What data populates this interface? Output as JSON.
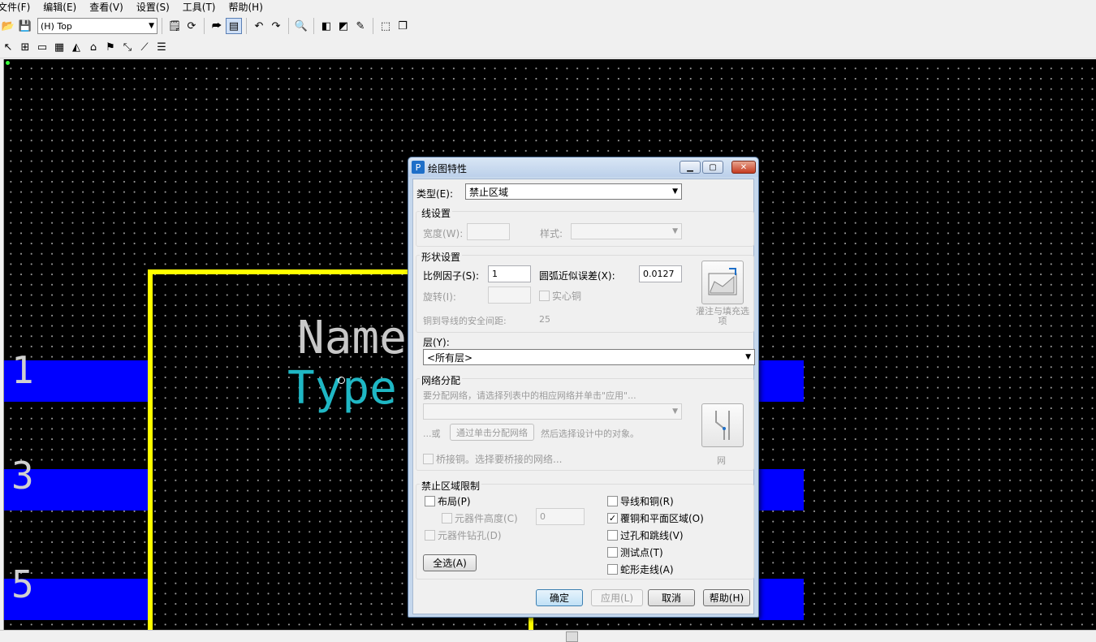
{
  "menu": [
    "文件(F)",
    "编辑(E)",
    "查看(V)",
    "设置(S)",
    "工具(T)",
    "帮助(H)"
  ],
  "toolbar": {
    "layer_selected": "(H) Top"
  },
  "canvas": {
    "pin_numbers": [
      "1",
      "3",
      "5"
    ],
    "name_text": "Name",
    "type_text": "Type",
    "colors": {
      "background": "#000000",
      "pad": "#0000ff",
      "outline": "#ffff00",
      "name_text": "#c8c8c8",
      "type_text": "#1fb7c4"
    }
  },
  "dialog": {
    "title": "绘图特性",
    "type_label": "类型(E):",
    "type_value": "禁止区域",
    "line_settings": {
      "title": "线设置",
      "width_label": "宽度(W):",
      "style_label": "样式:"
    },
    "shape_settings": {
      "title": "形状设置",
      "scale_label": "比例因子(S):",
      "scale_value": "1",
      "arc_label": "圆弧近似误差(X):",
      "arc_value": "0.0127",
      "rotate_label": "旋转(I):",
      "solid_copper_label": "实心铜",
      "clearance_label": "铜到导线的安全间距:",
      "clearance_value": "25",
      "flood_button_label": "灌注与填充选项"
    },
    "layer": {
      "label": "层(Y):",
      "value": "<所有层>"
    },
    "net_assign": {
      "title": "网络分配",
      "hint": "要分配网络，请选择列表中的相应网络并单击\"应用\"...",
      "or_label": "...或",
      "assign_by_click_button": "通过单击分配网络",
      "then_label": "然后选择设计中的对象。",
      "bridge_copper_label": "桥接铜。选择要桥接的网络...",
      "net_button_label": "网"
    },
    "restrictions": {
      "title": "禁止区域限制",
      "placement": {
        "label": "布局(P)",
        "checked": false
      },
      "component_height": {
        "label": "元器件高度(C)",
        "checked": false,
        "value": "0"
      },
      "component_drill": {
        "label": "元器件钻孔(D)",
        "checked": false
      },
      "trace_copper": {
        "label": "导线和铜(R)",
        "checked": false
      },
      "copper_pour_plane": {
        "label": "覆铜和平面区域(O)",
        "checked": true
      },
      "via_jumper": {
        "label": "过孔和跳线(V)",
        "checked": false
      },
      "test_point": {
        "label": "测试点(T)",
        "checked": false
      },
      "serpentine": {
        "label": "蛇形走线(A)",
        "checked": false
      },
      "select_all_button": "全选(A)"
    },
    "buttons": {
      "ok": "确定",
      "apply": "应用(L)",
      "cancel": "取消",
      "help": "帮助(H)"
    },
    "check_mark": "✓"
  }
}
